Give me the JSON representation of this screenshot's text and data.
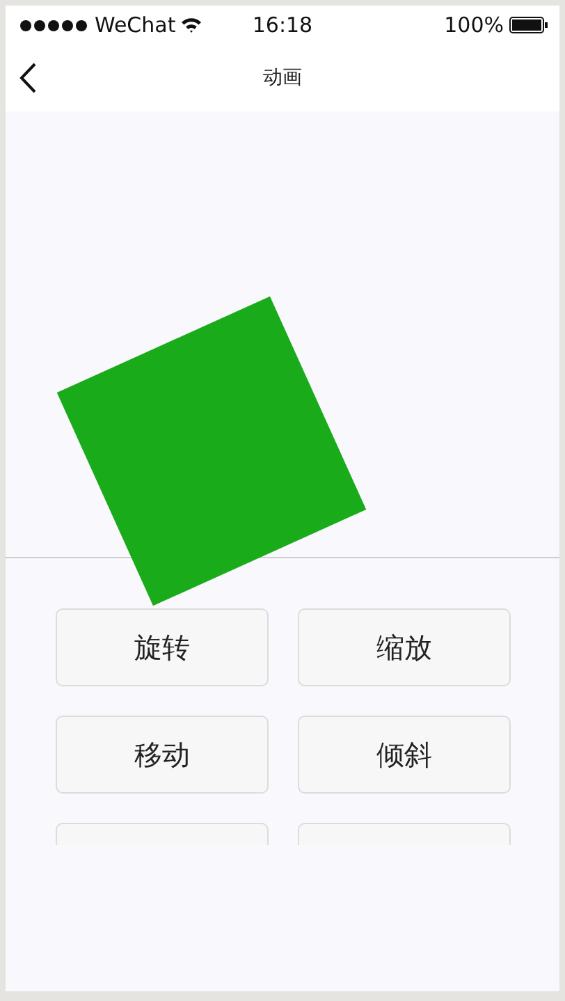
{
  "status_bar": {
    "carrier": "WeChat",
    "time": "16:18",
    "battery": "100%"
  },
  "nav_bar": {
    "title": "动画"
  },
  "buttons": [
    {
      "kind": "button",
      "label": "旋转"
    },
    {
      "kind": "button",
      "label": "缩放"
    },
    {
      "kind": "button",
      "label": "移动"
    },
    {
      "kind": "button",
      "label": "倾斜"
    },
    {
      "kind": "cut"
    },
    {
      "kind": "cut"
    }
  ]
}
